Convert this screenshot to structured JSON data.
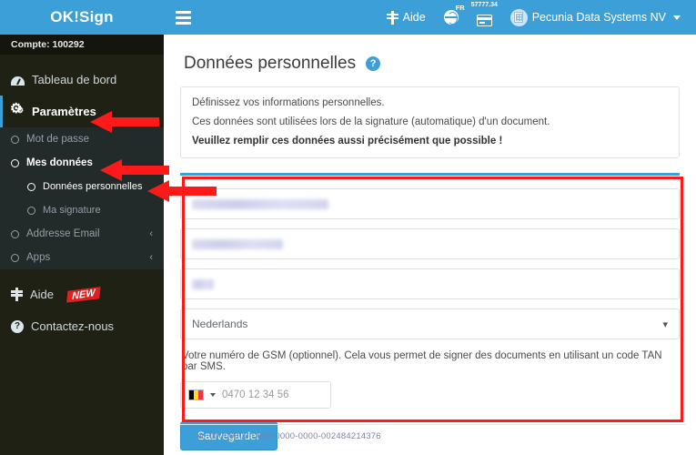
{
  "topbar": {
    "brand": "OK!Sign",
    "menu_icon": "hamburger-icon",
    "help_label": "Aide",
    "language_code": "FR",
    "credits": "57777.34",
    "company": "Pecunia Data Systems NV"
  },
  "sidebar": {
    "account_label": "Compte: 100292",
    "dashboard": "Tableau de bord",
    "settings": "Paramètres",
    "sub_items": [
      {
        "label": "Mot de passe",
        "level": 1,
        "selected": false,
        "chevron": ""
      },
      {
        "label": "Mes données",
        "level": 1,
        "selected": true,
        "chevron": ""
      },
      {
        "label": "Données personnelles",
        "level": 2,
        "selected": true,
        "chevron": ""
      },
      {
        "label": "Ma signature",
        "level": 2,
        "selected": false,
        "chevron": ""
      },
      {
        "label": "Addresse Email",
        "level": 1,
        "selected": false,
        "chevron": "‹"
      },
      {
        "label": "Apps",
        "level": 1,
        "selected": false,
        "chevron": "‹"
      }
    ],
    "help": "Aide",
    "help_badge": "NEW",
    "contact": "Contactez-nous"
  },
  "main": {
    "page_title": "Données personnelles",
    "help_icon_glyph": "?",
    "info": {
      "line1": "Définissez vos informations personnelles.",
      "line2": "Ces données sont utilisées lors de la signature (automatique) d'un document.",
      "line3": "Veuillez remplir ces données aussi précisément que possible !"
    },
    "form": {
      "field1_value": "",
      "field2_value": "",
      "field3_value": "",
      "language_select_value": "Nederlands",
      "gsm_note": "Votre numéro de GSM (optionnel). Cela vous permet de signer des documents en utilisant un code TAN par SMS.",
      "phone_country": "BE",
      "phone_placeholder": "0470 12 34 56",
      "save_label": "Sauvegarder"
    },
    "footer_id": "bt_00000000-0000-0000-0000-002484214376"
  },
  "annotations": {
    "color": "#ff1a1a",
    "arrow1_target": "Paramètres",
    "arrow2_target": "Mes données",
    "arrow3_target": "Données personnelles",
    "box_target": "personal-data-form"
  }
}
